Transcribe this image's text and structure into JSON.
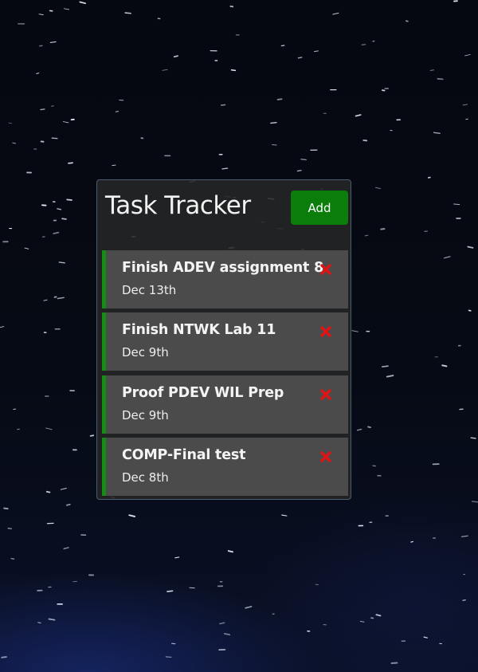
{
  "app": {
    "title": "Task Tracker",
    "add_button_label": "Add"
  },
  "tasks": [
    {
      "text": "Finish ADEV assignment 8",
      "day": "Dec 13th",
      "reminder": true,
      "delete_icon": "close-icon"
    },
    {
      "text": "Finish NTWK Lab 11",
      "day": "Dec 9th",
      "reminder": true,
      "delete_icon": "close-icon"
    },
    {
      "text": "Proof PDEV WIL Prep",
      "day": "Dec 9th",
      "reminder": true,
      "delete_icon": "close-icon"
    },
    {
      "text": "COMP-Final test",
      "day": "Dec 8th",
      "reminder": true,
      "delete_icon": "close-icon"
    }
  ],
  "colors": {
    "add_button": "#0b7d0b",
    "reminder_border": "#158c15",
    "delete_icon": "#e01414",
    "task_background": "#4b4b4c"
  }
}
